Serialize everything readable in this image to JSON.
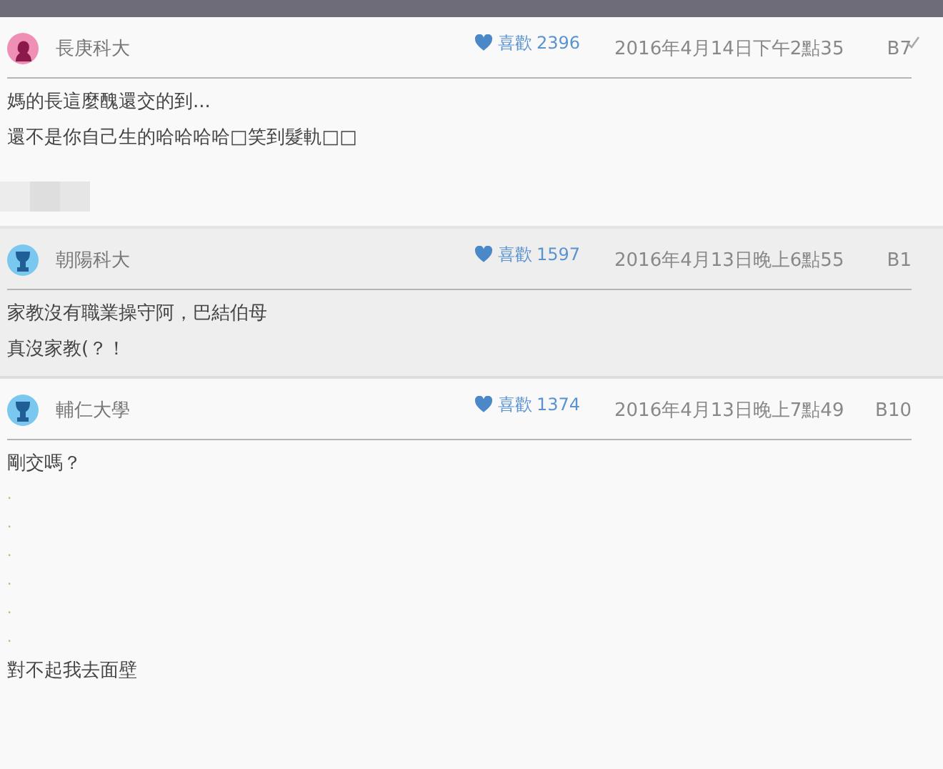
{
  "comments": [
    {
      "author": "長庚科大",
      "avatar": {
        "kind": "female"
      },
      "likes_label": "喜歡",
      "likes": "2396",
      "date": "2016年4月14日下午2點35",
      "floor": "B7",
      "checked": true,
      "highlighted": false,
      "lines": [
        "媽的長這麼醜還交的到...",
        "還不是你自己生的哈哈哈哈□笑到髮軌□□"
      ],
      "attachment": {
        "kind": "picture"
      }
    },
    {
      "author": "朝陽科大",
      "avatar": {
        "kind": "male"
      },
      "likes_label": "喜歡",
      "likes": "1597",
      "date": "2016年4月13日晚上6點55",
      "floor": "B1",
      "checked": false,
      "highlighted": true,
      "lines": [
        "家教沒有職業操守阿，巴結伯母",
        "真沒家教(？！"
      ]
    },
    {
      "author": "輔仁大學",
      "avatar": {
        "kind": "male"
      },
      "likes_label": "喜歡",
      "likes": "1374",
      "date": "2016年4月13日晚上7點49",
      "floor": "B10",
      "checked": false,
      "highlighted": false,
      "lines": [
        "剛交嗎？",
        ".",
        ".",
        ".",
        ".",
        ".",
        ".",
        "對不起我去面壁"
      ]
    }
  ]
}
